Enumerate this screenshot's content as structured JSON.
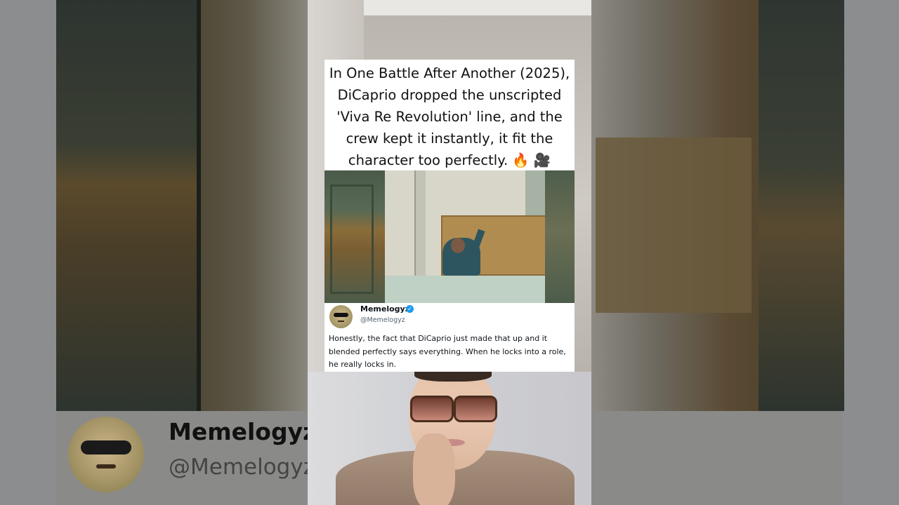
{
  "post": {
    "caption": "In One Battle After Another (2025), DiCaprio dropped the unscripted 'Viva Re Revolution' line, and the crew kept it instantly, it fit the character too perfectly. 🔥 🎥",
    "caption_lines": [
      "In One Battle After Another (2025),",
      "DiCaprio dropped the unscripted",
      "'Viva Re Revolution' line, and the",
      "crew kept it instantly, it fit the",
      "character too perfectly. 🔥 🎥"
    ]
  },
  "tweet": {
    "display_name": "Memelogyz",
    "handle": "@Memelogyz",
    "verified_icon": "verified-badge-icon",
    "body": "Honestly, the fact that DiCaprio just made that up and it blended perfectly says everything. When he locks into a role, he really locks in."
  },
  "background_profile": {
    "display_name": "Memelogyz",
    "handle": "@Memelogyz"
  },
  "colors": {
    "verified": "#1d9bf0",
    "card_bg": "#ffffff",
    "text": "#0f1419",
    "handle_text": "#536471"
  }
}
